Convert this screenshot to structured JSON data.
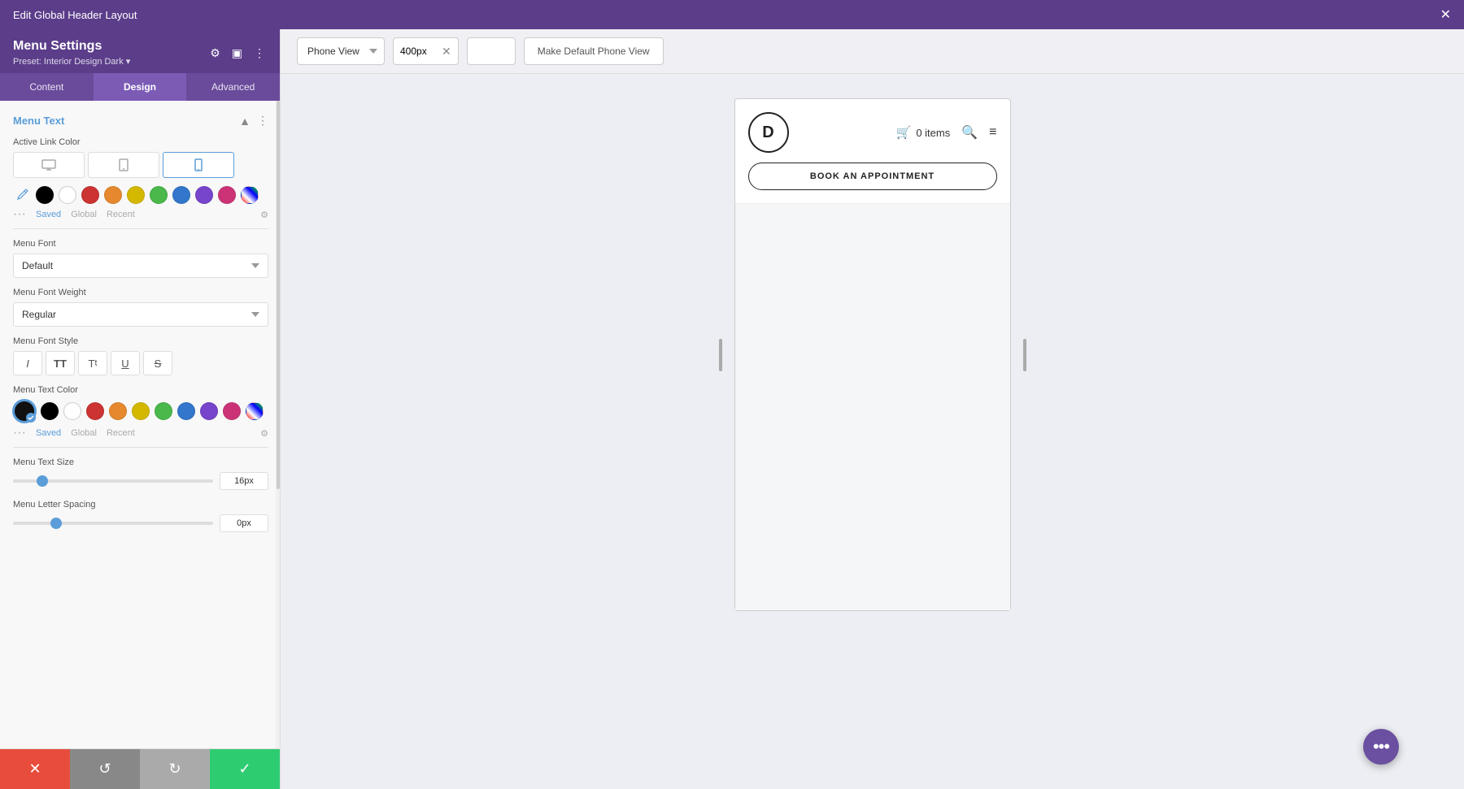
{
  "titleBar": {
    "title": "Edit Global Header Layout",
    "closeLabel": "✕"
  },
  "panel": {
    "title": "Menu Settings",
    "preset": "Preset: Interior Design Dark ▾",
    "tabs": [
      {
        "label": "Content",
        "active": false
      },
      {
        "label": "Design",
        "active": true
      },
      {
        "label": "Advanced",
        "active": false
      }
    ],
    "icons": {
      "settings": "⚙",
      "layout": "▣",
      "more": "⋮"
    }
  },
  "menuText": {
    "sectionTitle": "Menu Text",
    "activeLinkColor": {
      "label": "Active Link Color",
      "devices": [
        "desktop",
        "tablet",
        "mobile"
      ],
      "colors": [
        "#000000",
        "#ffffff",
        "#cc3333",
        "#e6882e",
        "#d4b800",
        "#4ab84a",
        "#3377cc",
        "#7744cc",
        "#cc3377",
        "eraser"
      ],
      "colorTabs": [
        "Saved",
        "Global",
        "Recent"
      ],
      "activeTab": "Saved"
    },
    "menuFont": {
      "label": "Menu Font",
      "value": "Default"
    },
    "menuFontWeight": {
      "label": "Menu Font Weight",
      "value": "Regular"
    },
    "menuFontStyle": {
      "label": "Menu Font Style",
      "buttons": [
        "I",
        "TT",
        "Tt",
        "U",
        "S"
      ]
    },
    "menuTextColor": {
      "label": "Menu Text Color",
      "activeColor": "#111111",
      "colors": [
        "#000000",
        "#ffffff",
        "#cc3333",
        "#e6882e",
        "#d4b800",
        "#4ab84a",
        "#3377cc",
        "#7744cc",
        "#cc3377",
        "eraser"
      ]
    },
    "menuTextSize": {
      "label": "Menu Text Size",
      "value": 16,
      "unit": "px",
      "displayValue": "16px"
    },
    "menuLetterSpacing": {
      "label": "Menu Letter Spacing",
      "value": 0,
      "unit": "px",
      "displayValue": "0px"
    }
  },
  "bottomBar": {
    "cancelIcon": "✕",
    "undoIcon": "↺",
    "redoIcon": "↻",
    "saveIcon": "✓"
  },
  "toolbar": {
    "viewLabel": "Phone View",
    "widthValue": "400px",
    "closeIcon": "✕",
    "makeDefaultLabel": "Make Default Phone View"
  },
  "preview": {
    "logoText": "D",
    "cartIcon": "🛒",
    "cartItems": "0 items",
    "searchIcon": "🔍",
    "hamburgerIcon": "≡",
    "bookLabel": "BOOK AN APPOINTMENT"
  },
  "fab": {
    "icon": "•••"
  }
}
